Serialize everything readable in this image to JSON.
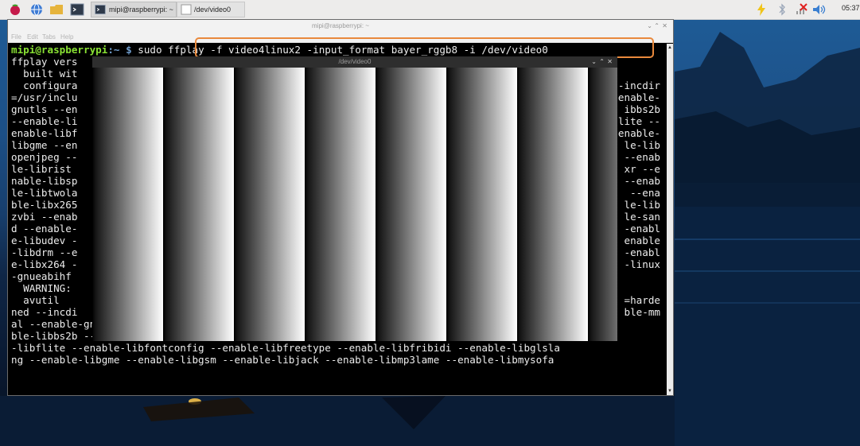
{
  "taskbar": {
    "apps": [
      {
        "name": "raspberry-menu-icon"
      },
      {
        "name": "web-browser-icon"
      },
      {
        "name": "file-manager-icon"
      },
      {
        "name": "terminal-icon"
      }
    ],
    "tasks": [
      {
        "label": "mipi@raspberrypi: ~",
        "icon": "terminal-icon"
      },
      {
        "label": "/dev/video0",
        "icon": "video-window-icon"
      }
    ],
    "tray": [
      "bluetooth-icon",
      "network-disconnected-icon",
      "volume-icon",
      "power-icon"
    ],
    "clock": "05:37"
  },
  "terminal": {
    "title": "mipi@raspberrypi: ~",
    "menu": [
      "File",
      "Edit",
      "Tabs",
      "Help"
    ],
    "prompt_user": "mipi@raspberrypi",
    "prompt_sep": ":~ $ ",
    "command": "sudo ffplay -f video4linux2 -input_format bayer_rggb8 -i /dev/video0",
    "lines_left": [
      "ffplay vers",
      "  built wit",
      "  configura",
      "=/usr/inclu",
      "gnutls --en",
      "--enable-li",
      "enable-libf",
      "libgme --en",
      "openjpeg --",
      "le-librist ",
      "nable-libsp",
      "le-libtwola",
      "ble-libx265",
      "zvbi --enab",
      "d --enable-",
      "e-libudev -",
      "-libdrm --e",
      "e-libx264 -",
      "-gnueabihf",
      "  WARNING: ",
      "  avutil   ",
      "ned --incdi"
    ],
    "lines_right": [
      "",
      "",
      "-incdir",
      "enable-",
      "ibbs2b",
      "lite --",
      "enable-",
      "le-lib",
      "--enab",
      "xr --e",
      "--enab",
      " --ena",
      "le-lib",
      "le-san",
      "-enabl",
      "enable",
      "-enabl",
      "-linux",
      "",
      "",
      "=harde",
      "ble-mm"
    ],
    "lines_full": [
      "al --enable-gnutls --enable-ladspa --enable-libaom --enable-libass --enable-libbluray --ena",
      "ble-libbs2b --enable-libcaca --enable-libcdio --enable-libcodec2 --enable-libdav1d --enable",
      "-libflite --enable-libfontconfig --enable-libfreetype --enable-libfribidi --enable-libglsla",
      "ng --enable-libgme --enable-libgsm --enable-libjack --enable-libmp3lame --enable-libmysofa"
    ]
  },
  "video_window": {
    "title": "/dev/video0",
    "controls": [
      "minimize-icon",
      "maximize-icon",
      "close-icon"
    ]
  },
  "colors": {
    "highlight": "#e9893c",
    "prompt_user": "#8ae234",
    "prompt_path": "#729fcf"
  }
}
